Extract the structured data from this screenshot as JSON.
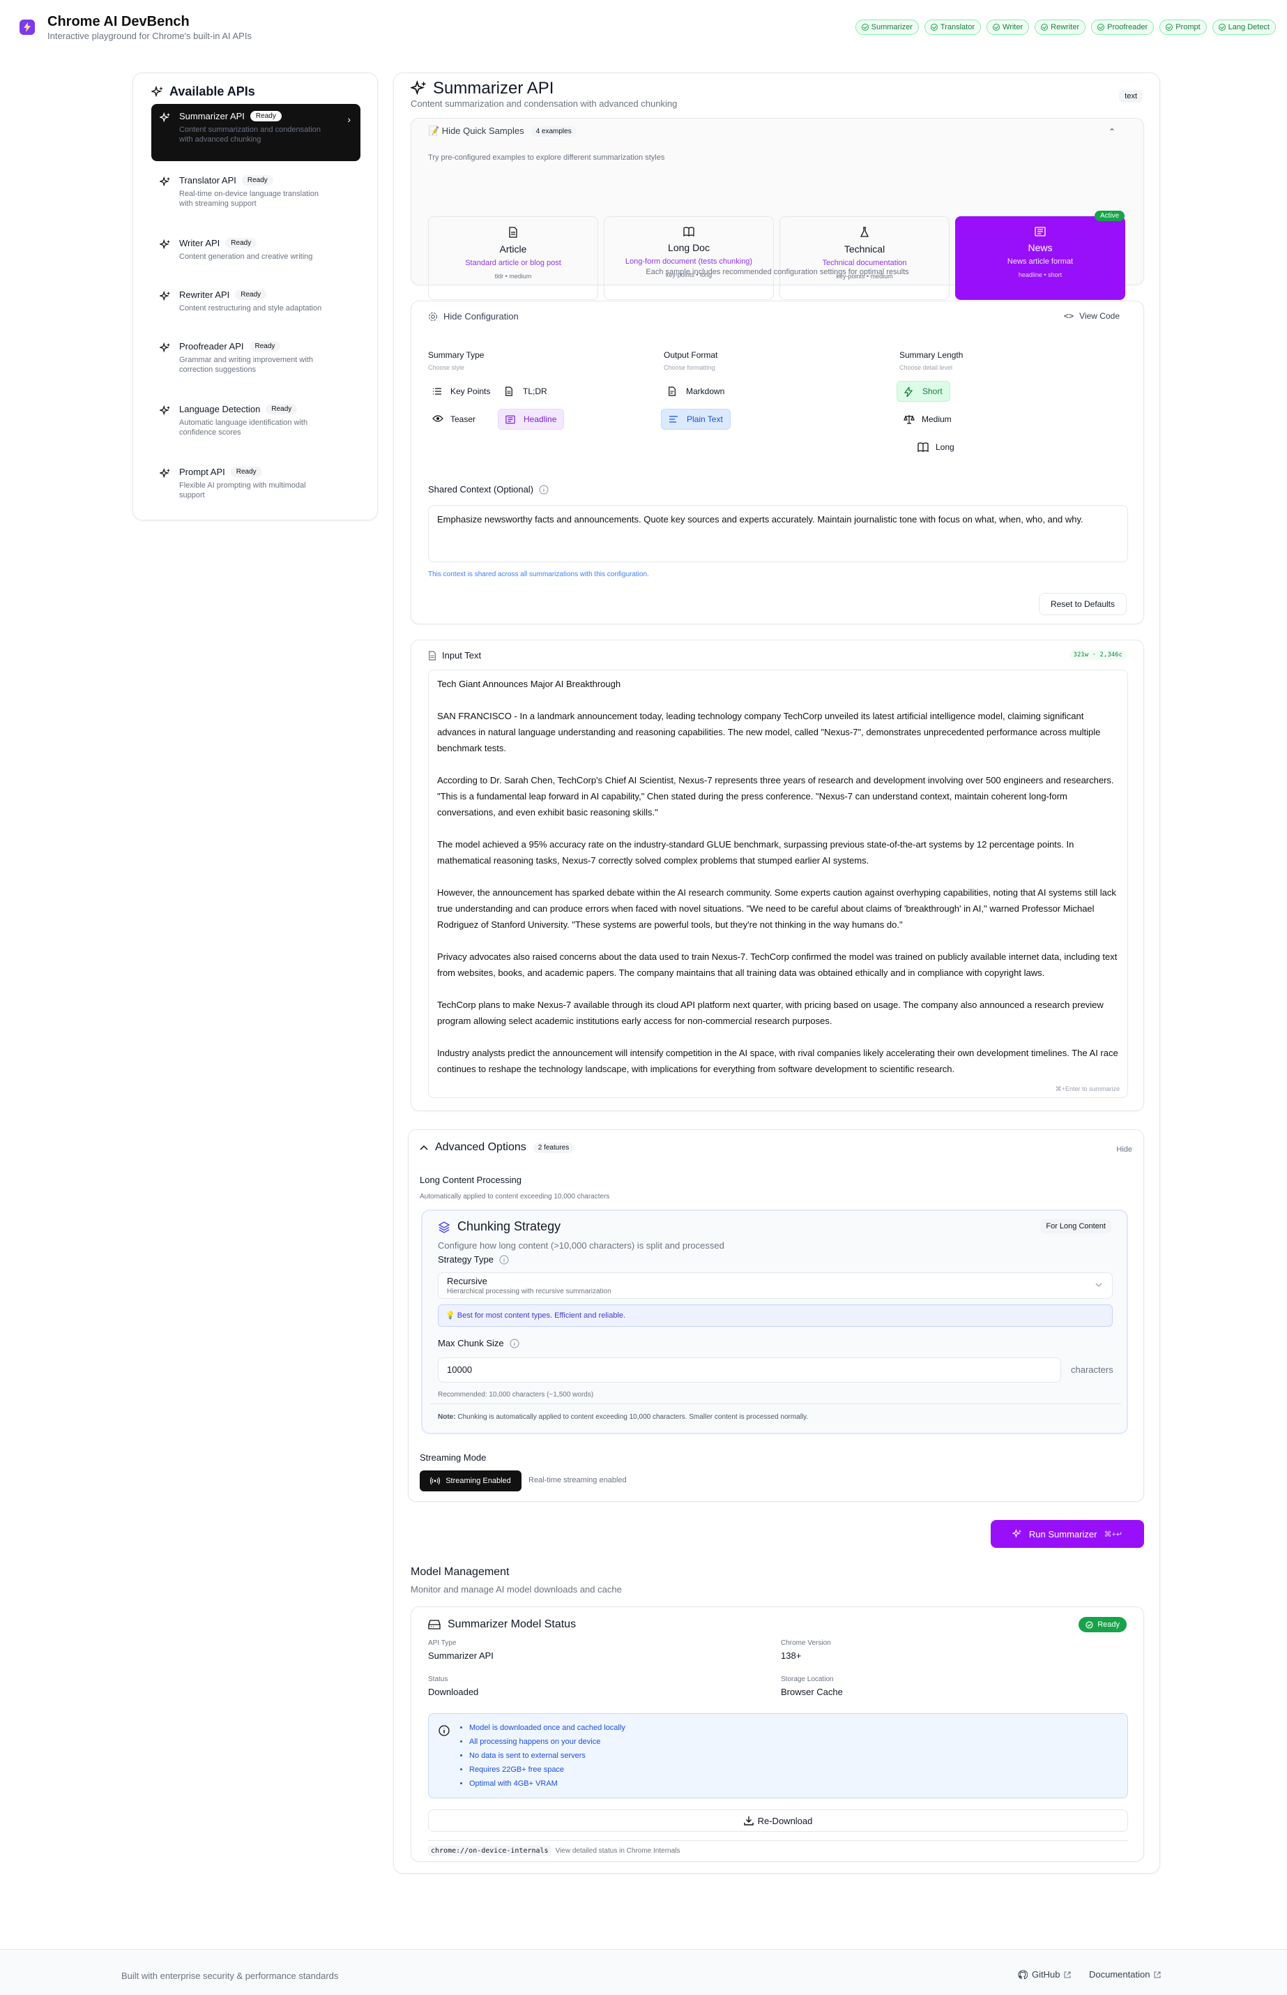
{
  "app": {
    "title": "Chrome AI DevBench",
    "subtitle": "Interactive playground for Chrome's built-in AI APIs"
  },
  "header_chips": [
    "Summarizer",
    "Translator",
    "Writer",
    "Rewriter",
    "Proofreader",
    "Prompt",
    "Lang Detect"
  ],
  "sidebar": {
    "title": "Available APIs",
    "items": [
      {
        "name": "Summarizer API",
        "badge": "Ready",
        "desc": "Content summarization and condensation with advanced chunking"
      },
      {
        "name": "Translator API",
        "badge": "Ready",
        "desc": "Real-time on-device language translation with streaming support"
      },
      {
        "name": "Writer API",
        "badge": "Ready",
        "desc": "Content generation and creative writing"
      },
      {
        "name": "Rewriter API",
        "badge": "Ready",
        "desc": "Content restructuring and style adaptation"
      },
      {
        "name": "Proofreader API",
        "badge": "Ready",
        "desc": "Grammar and writing improvement with correction suggestions"
      },
      {
        "name": "Language Detection",
        "badge": "Ready",
        "desc": "Automatic language identification with confidence scores"
      },
      {
        "name": "Prompt API",
        "badge": "Ready",
        "desc": "Flexible AI prompting with multimodal support"
      }
    ]
  },
  "main": {
    "title": "Summarizer API",
    "subtitle": "Content summarization and condensation with advanced chunking",
    "type_badge": "text"
  },
  "samples": {
    "toggle": "📝 Hide Quick Samples",
    "count": "4 examples",
    "hint": "Try pre-configured examples to explore different summarization styles",
    "items": [
      {
        "title": "Article",
        "sub": "Standard article or blog post",
        "meta": "tldr • medium"
      },
      {
        "title": "Long Doc",
        "sub": "Long-form document (tests chunking)",
        "meta": "key-points • long"
      },
      {
        "title": "Technical",
        "sub": "Technical documentation",
        "meta": "key-points • medium"
      },
      {
        "title": "News",
        "sub": "News article format",
        "meta": "headline • short"
      }
    ],
    "active_badge": "Active",
    "footer": "Each sample includes recommended configuration settings for optimal results"
  },
  "config": {
    "toggle": "Hide Configuration",
    "view_code": "View Code",
    "summary_type": {
      "label": "Summary Type",
      "hint": "Choose style",
      "options": [
        "Key Points",
        "TL;DR",
        "Teaser",
        "Headline"
      ],
      "selected": "Headline"
    },
    "output_format": {
      "label": "Output Format",
      "hint": "Choose formatting",
      "options": [
        "Markdown",
        "Plain Text"
      ],
      "selected": "Plain Text"
    },
    "summary_length": {
      "label": "Summary Length",
      "hint": "Choose detail level",
      "options": [
        "Short",
        "Medium",
        "Long"
      ],
      "selected": "Short"
    },
    "context_label": "Shared Context (Optional)",
    "context_value": "Emphasize newsworthy facts and announcements. Quote key sources and experts accurately. Maintain journalistic tone with focus on what, when, who, and why.",
    "context_hint": "This context is shared across all summarizations with this configuration.",
    "reset": "Reset to Defaults"
  },
  "input": {
    "label": "Input Text",
    "counter": "321w · 2,346c",
    "shortcut_hint": "⌘+Enter to summarize",
    "paragraphs": [
      "Tech Giant Announces Major AI Breakthrough",
      "SAN FRANCISCO - In a landmark announcement today, leading technology company TechCorp unveiled its latest artificial intelligence model, claiming significant advances in natural language understanding and reasoning capabilities. The new model, called \"Nexus-7\", demonstrates unprecedented performance across multiple benchmark tests.",
      "According to Dr. Sarah Chen, TechCorp's Chief AI Scientist, Nexus-7 represents three years of research and development involving over 500 engineers and researchers. \"This is a fundamental leap forward in AI capability,\" Chen stated during the press conference. \"Nexus-7 can understand context, maintain coherent long-form conversations, and even exhibit basic reasoning skills.\"",
      "The model achieved a 95% accuracy rate on the industry-standard GLUE benchmark, surpassing previous state-of-the-art systems by 12 percentage points. In mathematical reasoning tasks, Nexus-7 correctly solved complex problems that stumped earlier AI systems.",
      "However, the announcement has sparked debate within the AI research community. Some experts caution against overhyping capabilities, noting that AI systems still lack true understanding and can produce errors when faced with novel situations. \"We need to be careful about claims of 'breakthrough' in AI,\" warned Professor Michael Rodriguez of Stanford University. \"These systems are powerful tools, but they're not thinking in the way humans do.\"",
      "Privacy advocates also raised concerns about the data used to train Nexus-7. TechCorp confirmed the model was trained on publicly available internet data, including text from websites, books, and academic papers. The company maintains that all training data was obtained ethically and in compliance with copyright laws.",
      "TechCorp plans to make Nexus-7 available through its cloud API platform next quarter, with pricing based on usage. The company also announced a research preview program allowing select academic institutions early access for non-commercial research purposes.",
      "Industry analysts predict the announcement will intensify competition in the AI space, with rival companies likely accelerating their own development timelines. The AI race continues to reshape the technology landscape, with implications for everything from software development to scientific research."
    ]
  },
  "advanced": {
    "title": "Advanced Options",
    "count": "2 features",
    "hide": "Hide",
    "long_label": "Long Content Processing",
    "long_hint": "Automatically applied to content exceeding 10,000 characters",
    "chunk_title": "Chunking Strategy",
    "chunk_badge": "For Long Content",
    "chunk_desc": "Configure how long content (>10,000 characters) is split and processed",
    "strategy_label": "Strategy Type",
    "strategy_value": "Recursive",
    "strategy_sub": "Hierarchical processing with recursive summarization",
    "strategy_tip": "💡 Best for most content types. Efficient and reliable.",
    "max_label": "Max Chunk Size",
    "max_value": "10000",
    "max_unit": "characters",
    "max_hint": "Recommended: 10,000 characters (~1,500 words)",
    "note_label": "Note:",
    "note_text": "Chunking is automatically applied to content exceeding 10,000 characters. Smaller content is processed normally.",
    "stream_label": "Streaming Mode",
    "stream_btn": "Streaming Enabled",
    "stream_hint": "Real-time streaming enabled"
  },
  "run": {
    "label": "Run Summarizer",
    "shortcut": "⌘+↵"
  },
  "model": {
    "section_title": "Model Management",
    "section_sub": "Monitor and manage AI model downloads and cache",
    "card_title": "Summarizer Model Status",
    "status_badge": "Ready",
    "fields": [
      {
        "label": "API Type",
        "value": "Summarizer API"
      },
      {
        "label": "Chrome Version",
        "value": "138+"
      },
      {
        "label": "Status",
        "value": "Downloaded"
      },
      {
        "label": "Storage Location",
        "value": "Browser Cache"
      }
    ],
    "info": [
      "Model is downloaded once and cached locally",
      "All processing happens on your device",
      "No data is sent to external servers",
      "Requires 22GB+ free space",
      "Optimal with 4GB+ VRAM"
    ],
    "redownload": "Re-Download",
    "internals_code": "chrome://on-device-internals",
    "internals_text": "View detailed status in Chrome Internals"
  },
  "footer": {
    "left": "Built with enterprise security & performance standards",
    "github": "GitHub",
    "docs": "Documentation"
  },
  "colors": {
    "accent": "#9810fa",
    "ready": "#16a34a",
    "info_bg": "#eff6ff"
  }
}
